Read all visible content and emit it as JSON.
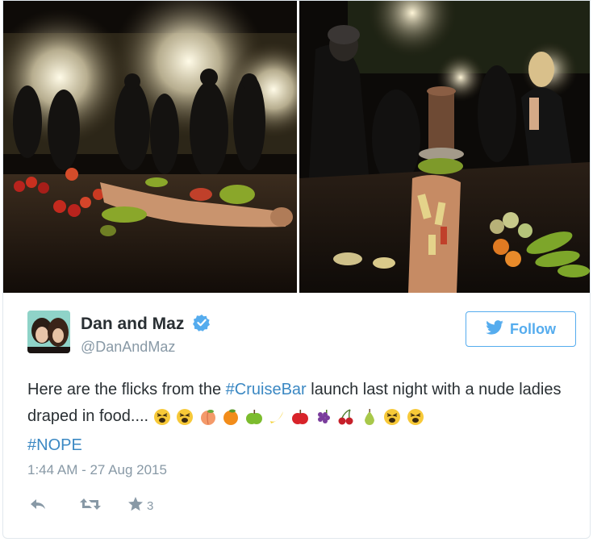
{
  "media": {
    "left_photo": "bar-launch-photo-1",
    "right_photo": "bar-launch-photo-2"
  },
  "author": {
    "display_name": "Dan and Maz",
    "handle": "@DanAndMaz",
    "verified": true,
    "verified_color": "#55acee"
  },
  "follow": {
    "label": "Follow",
    "icon": "twitter-bird-icon",
    "color": "#55acee"
  },
  "tweet": {
    "text_before": "Here are the flicks from the ",
    "hashtag1": "#CruiseBar",
    "text_after": " launch last night with a nude ladies draped in food.... ",
    "hashtag2": "#NOPE",
    "hashtag_color": "#3b88c3",
    "emojis": [
      "tired-face",
      "tired-face",
      "peach",
      "tangerine",
      "green-apple",
      "banana",
      "red-apple",
      "grapes",
      "cherries",
      "pear",
      "tired-face",
      "tired-face"
    ]
  },
  "timestamp": "1:44 AM - 27 Aug 2015",
  "actions": {
    "reply_icon": "reply-icon",
    "retweet_icon": "retweet-icon",
    "favorite_icon": "star-icon",
    "favorite_count": "3"
  }
}
